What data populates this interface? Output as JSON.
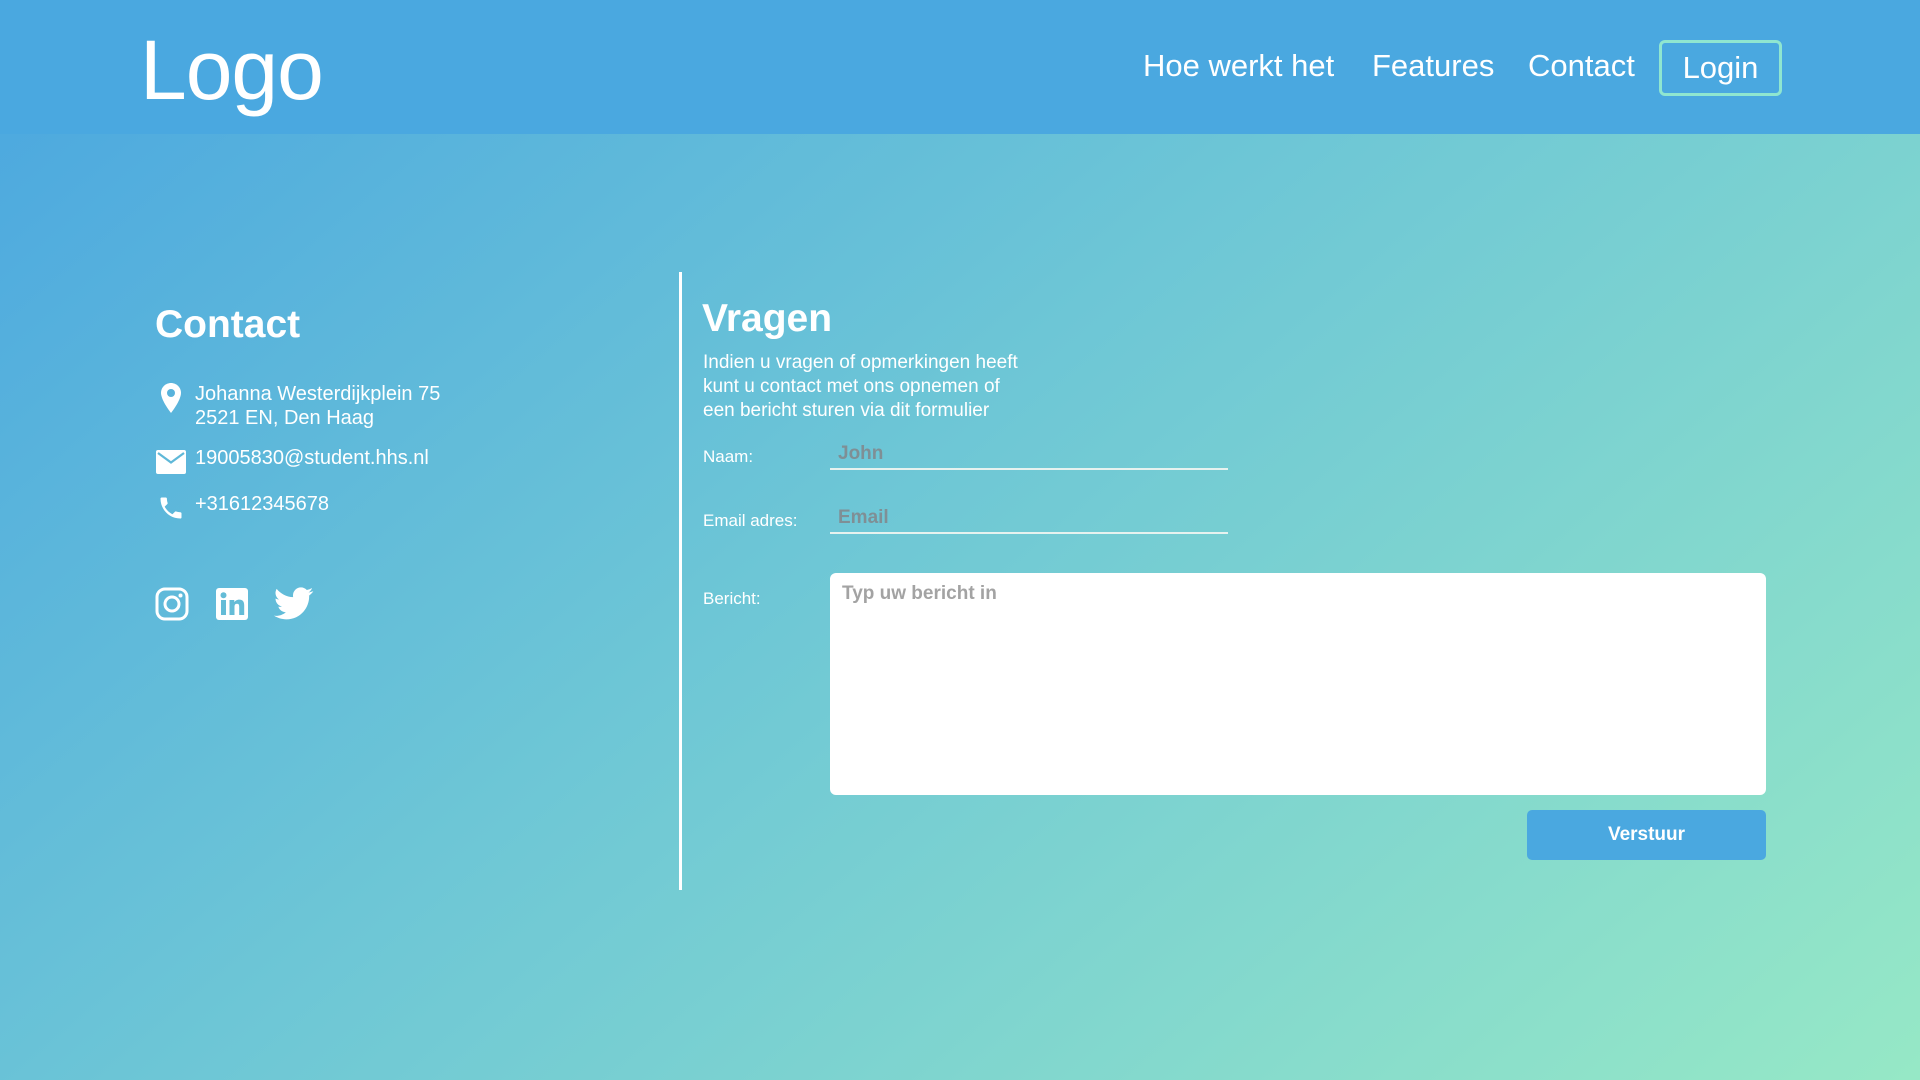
{
  "header": {
    "logo": "Logo",
    "nav": [
      {
        "label": "Hoe werkt het"
      },
      {
        "label": "Features"
      },
      {
        "label": "Contact"
      }
    ],
    "login_label": "Login"
  },
  "contact": {
    "title": "Contact",
    "address_line1": "Johanna Westerdijkplein 75",
    "address_line2": "2521 EN, Den Haag",
    "email": "19005830@student.hhs.nl",
    "phone": "+31612345678",
    "icons": [
      "location-pin-icon",
      "envelope-icon",
      "phone-icon"
    ],
    "social": [
      "instagram-icon",
      "linkedin-icon",
      "twitter-icon"
    ]
  },
  "form": {
    "title": "Vragen",
    "intro_line1": "Indien u vragen of opmerkingen heeft",
    "intro_line2": "kunt u contact met ons opnemen of",
    "intro_line3": "een bericht sturen via dit formulier",
    "name_label": "Naam:",
    "name_placeholder": "John",
    "email_label": "Email adres:",
    "email_placeholder": "Email",
    "message_label": "Bericht:",
    "message_placeholder": "Typ uw bericht in",
    "submit_label": "Verstuur"
  },
  "colors": {
    "header_bg": "#4aa8e0",
    "gradient_start": "#4aa6e0",
    "gradient_end": "#96e8c6",
    "login_border": "#8fe6d0",
    "button_bg": "#4aa8e0"
  }
}
